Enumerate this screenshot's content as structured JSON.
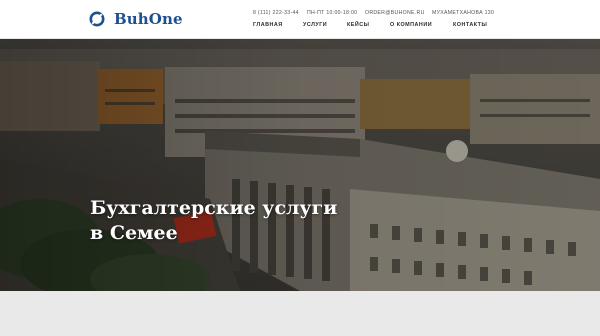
{
  "brand": {
    "name": "BuhOne",
    "color": "#1d4f91"
  },
  "contacts": {
    "phone": "8 (111) 222-33-44",
    "hours": "ПН-ПТ 10:00-18:00",
    "email": "ORDER@BUHONE.RU",
    "address": "МУХАМЕТХАНОВА 130"
  },
  "nav": {
    "items": [
      {
        "label": "ГЛАВНАЯ"
      },
      {
        "label": "УСЛУГИ"
      },
      {
        "label": "КЕЙСЫ"
      },
      {
        "label": "О КОМПАНИИ"
      },
      {
        "label": "КОНТАКТЫ"
      }
    ]
  },
  "hero": {
    "title_line1": "Бухгалтерские услуги",
    "title_line2": "в Семее"
  }
}
